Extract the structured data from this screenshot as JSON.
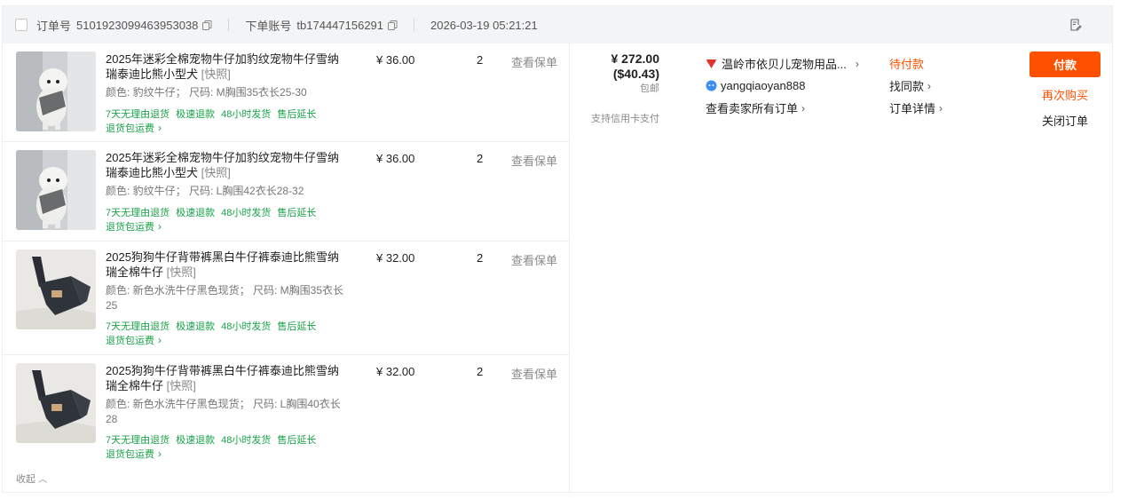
{
  "header": {
    "order_no_label": "订单号",
    "order_no": "5101923099463953038",
    "account_label": "下单账号",
    "account": "tb174447156291",
    "datetime": "2026-03-19 05:21:21"
  },
  "items": [
    {
      "title": "2025年迷彩全棉宠物牛仔加豹纹宠物牛仔雪纳瑞泰迪比熊小型犬",
      "snapshot": "[快照]",
      "spec": "颜色: 豹纹牛仔； 尺码: M胸围35衣长25-30",
      "services": [
        "7天无理由退货",
        "极速退款",
        "48小时发货",
        "售后延长"
      ],
      "return_fee": "退货包运费",
      "price": "¥ 36.00",
      "qty": "2",
      "policy": "查看保单",
      "image": "white-dog-photo"
    },
    {
      "title": "2025年迷彩全棉宠物牛仔加豹纹宠物牛仔雪纳瑞泰迪比熊小型犬",
      "snapshot": "[快照]",
      "spec": "颜色: 豹纹牛仔； 尺码: L胸围42衣长28-32",
      "services": [
        "7天无理由退货",
        "极速退款",
        "48小时发货",
        "售后延长"
      ],
      "return_fee": "退货包运费",
      "price": "¥ 36.00",
      "qty": "2",
      "policy": "查看保单",
      "image": "white-dog-photo"
    },
    {
      "title": "2025狗狗牛仔背带裤黑白牛仔裤泰迪比熊雪纳瑞全棉牛仔",
      "snapshot": "[快照]",
      "spec": "颜色: 新色水洗牛仔黑色现货； 尺码: M胸围35衣长25",
      "services": [
        "7天无理由退货",
        "极速退款",
        "48小时发货",
        "售后延长"
      ],
      "return_fee": "退货包运费",
      "price": "¥ 32.00",
      "qty": "2",
      "policy": "查看保单",
      "image": "denim-overall-photo"
    },
    {
      "title": "2025狗狗牛仔背带裤黑白牛仔裤泰迪比熊雪纳瑞全棉牛仔",
      "snapshot": "[快照]",
      "spec": "颜色: 新色水洗牛仔黑色现货； 尺码: L胸围40衣长28",
      "services": [
        "7天无理由退货",
        "极速退款",
        "48小时发货",
        "售后延长"
      ],
      "return_fee": "退货包运费",
      "price": "¥ 32.00",
      "qty": "2",
      "policy": "查看保单",
      "image": "denim-overall-photo"
    }
  ],
  "collapse_label": "收起",
  "total": {
    "amount": "¥ 272.00",
    "usd": "($40.43)",
    "shipping": "包邮",
    "credit_note": "支持信用卡支付"
  },
  "seller": {
    "shop_name": "温岭市依贝儿宠物用品...",
    "wangwang": "yangqiaoyan888",
    "all_orders": "查看卖家所有订单"
  },
  "status": {
    "state": "待付款",
    "find_similar": "找同款",
    "order_detail": "订单详情"
  },
  "actions": {
    "pay": "付款",
    "rebuy": "再次购买",
    "close": "关闭订单"
  },
  "colors": {
    "accent": "#ff5000",
    "service_green": "#1aa34a",
    "header_bg": "#f3f4f6"
  }
}
